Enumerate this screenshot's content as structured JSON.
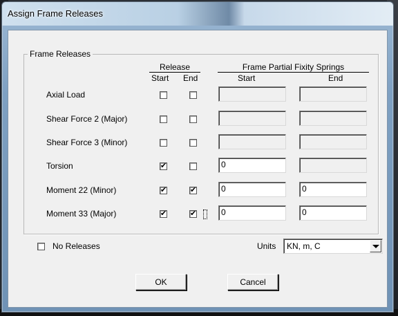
{
  "window": {
    "title": "Assign Frame Releases"
  },
  "group": {
    "title": "Frame Releases"
  },
  "headers": {
    "release": "Release",
    "release_start": "Start",
    "release_end": "End",
    "springs": "Frame Partial Fixity Springs",
    "springs_start": "Start",
    "springs_end": "End"
  },
  "rows": [
    {
      "label": "Axial Load",
      "release_start": false,
      "release_end": false,
      "spring_start": "",
      "spring_end": "",
      "spring_start_enabled": false,
      "spring_end_enabled": false
    },
    {
      "label": "Shear Force 2 (Major)",
      "release_start": false,
      "release_end": false,
      "spring_start": "",
      "spring_end": "",
      "spring_start_enabled": false,
      "spring_end_enabled": false
    },
    {
      "label": "Shear Force 3 (Minor)",
      "release_start": false,
      "release_end": false,
      "spring_start": "",
      "spring_end": "",
      "spring_start_enabled": false,
      "spring_end_enabled": false
    },
    {
      "label": "Torsion",
      "release_start": true,
      "release_end": false,
      "spring_start": "0",
      "spring_end": "",
      "spring_start_enabled": true,
      "spring_end_enabled": false
    },
    {
      "label": "Moment 22 (Minor)",
      "release_start": true,
      "release_end": true,
      "spring_start": "0",
      "spring_end": "0",
      "spring_start_enabled": true,
      "spring_end_enabled": true
    },
    {
      "label": "Moment 33 (Major)",
      "release_start": true,
      "release_end": true,
      "spring_start": "0",
      "spring_end": "0",
      "spring_start_enabled": true,
      "spring_end_enabled": true
    }
  ],
  "no_releases": {
    "label": "No Releases",
    "checked": false
  },
  "units": {
    "label": "Units",
    "value": "KN, m, C"
  },
  "buttons": {
    "ok": "OK",
    "cancel": "Cancel"
  }
}
